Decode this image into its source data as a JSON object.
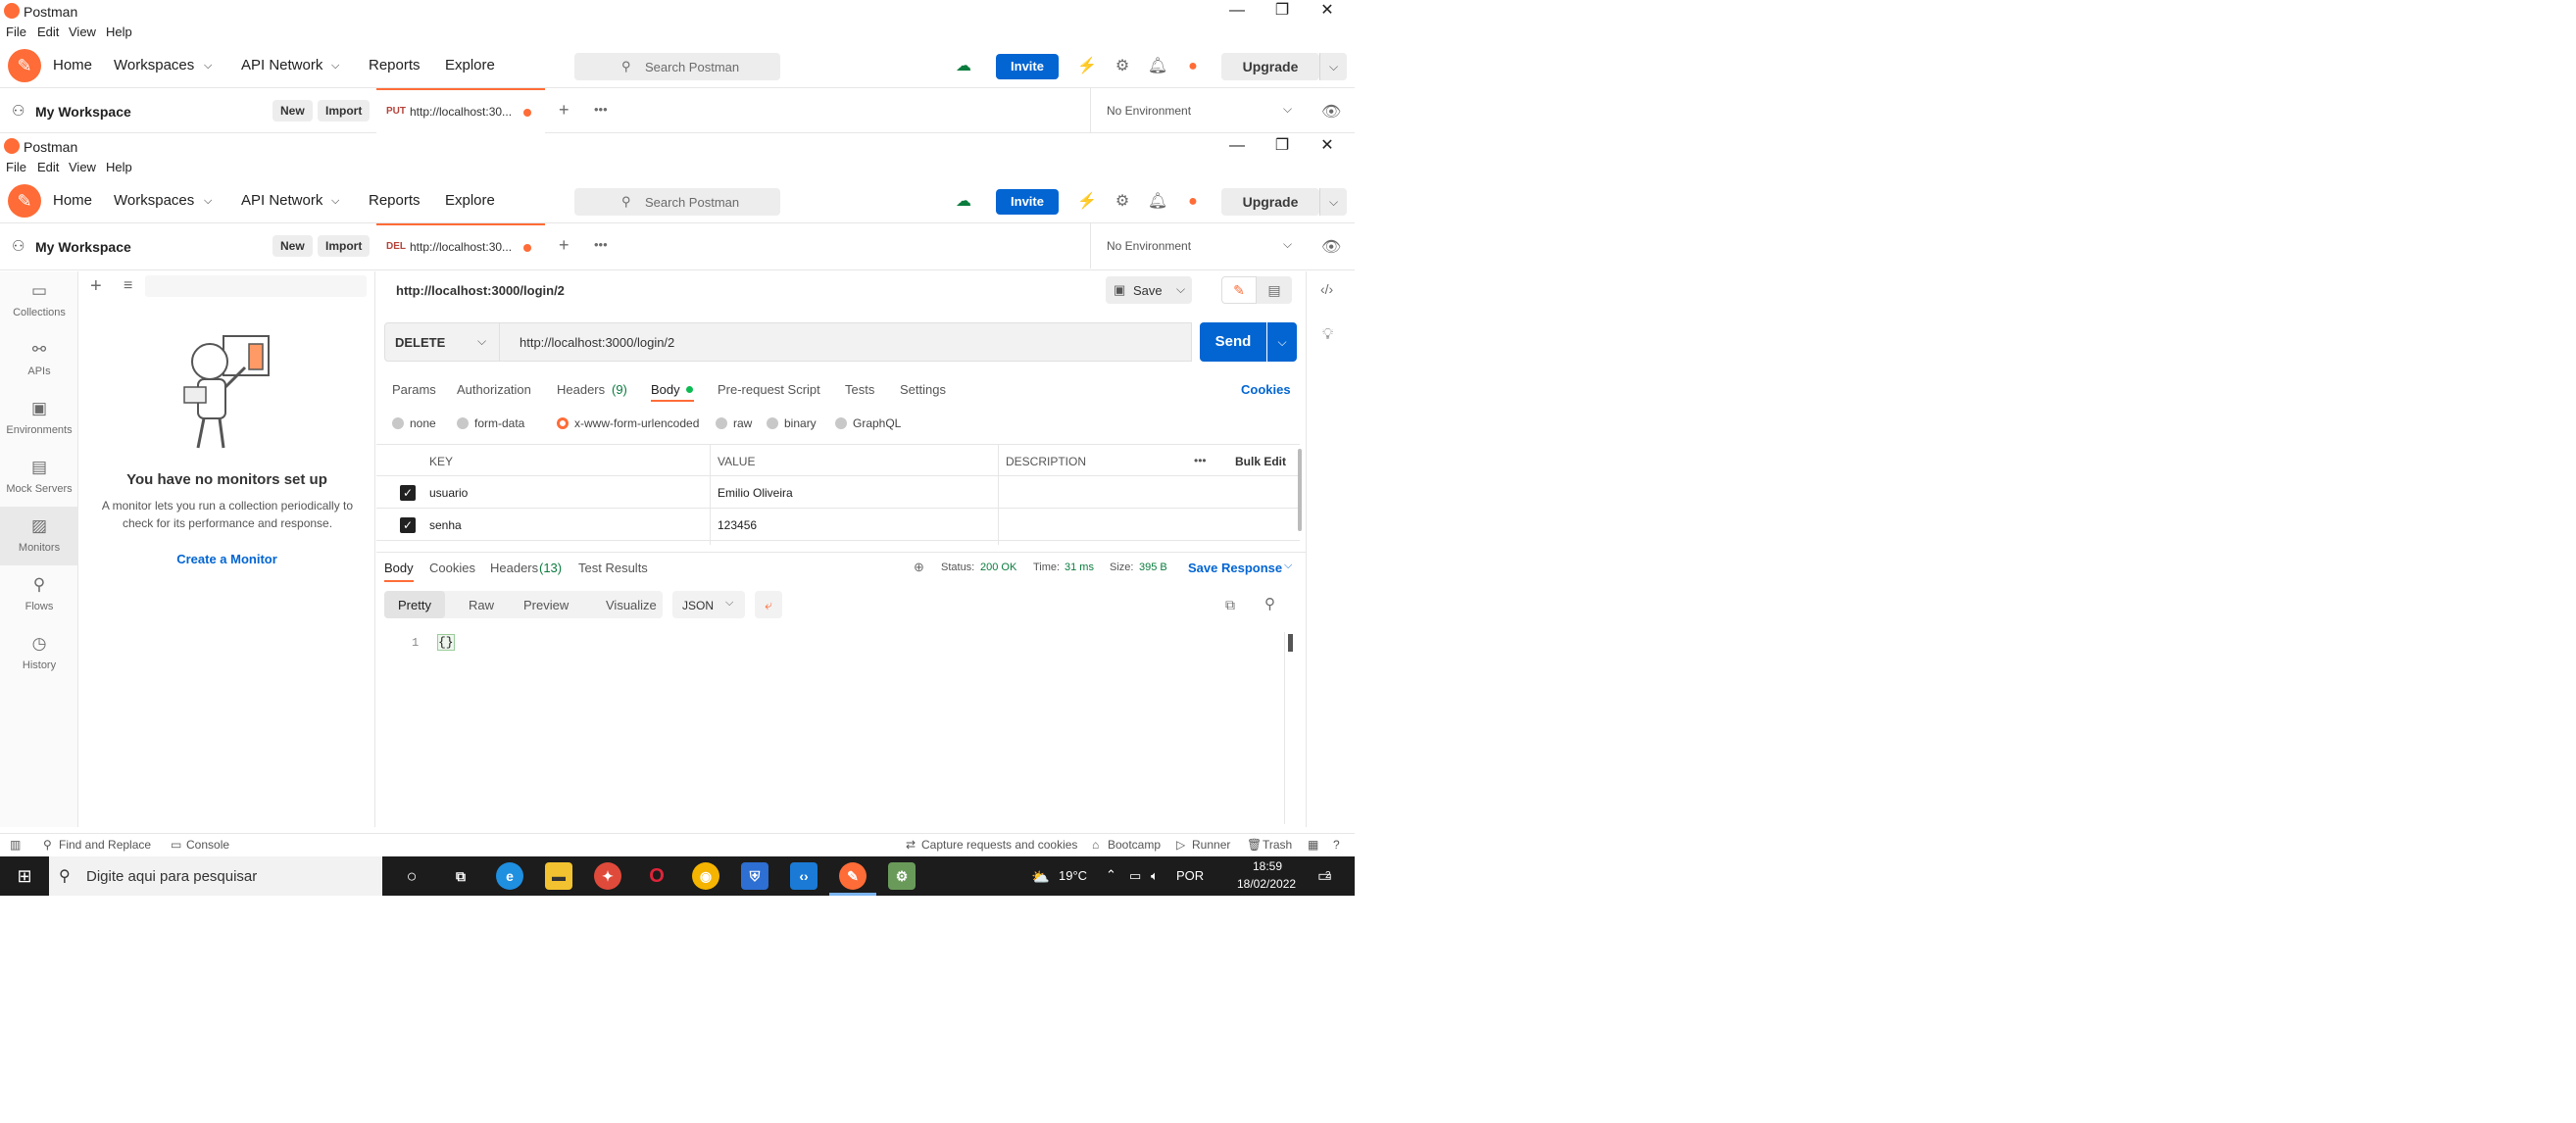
{
  "window": {
    "title": "Postman",
    "minimize": "—",
    "restore": "❐",
    "close": "✕"
  },
  "menu": {
    "file": "File",
    "edit": "Edit",
    "view": "View",
    "help": "Help"
  },
  "nav": {
    "home": "Home",
    "workspaces": "Workspaces",
    "api_network": "API Network",
    "reports": "Reports",
    "explore": "Explore",
    "search_placeholder": "Search Postman",
    "invite": "Invite",
    "upgrade": "Upgrade"
  },
  "workspace": {
    "name": "My Workspace",
    "new": "New",
    "import": "Import"
  },
  "back_tab": {
    "method": "PUT",
    "url": "http://localhost:30..."
  },
  "front_tab": {
    "method": "DEL",
    "url": "http://localhost:30..."
  },
  "environment": {
    "selected": "No Environment"
  },
  "rail": [
    {
      "label": "Collections",
      "icon": "collections-icon",
      "glyph": "▭"
    },
    {
      "label": "APIs",
      "icon": "apis-icon",
      "glyph": "⚯"
    },
    {
      "label": "Environments",
      "icon": "environments-icon",
      "glyph": "▣"
    },
    {
      "label": "Mock Servers",
      "icon": "mock-servers-icon",
      "glyph": "▤"
    },
    {
      "label": "Monitors",
      "icon": "monitors-icon",
      "glyph": "▨"
    },
    {
      "label": "Flows",
      "icon": "flows-icon",
      "glyph": "⚲"
    },
    {
      "label": "History",
      "icon": "history-icon",
      "glyph": "◷"
    }
  ],
  "monitors_panel": {
    "empty_title": "You have no monitors set up",
    "empty_desc": "A monitor lets you run a collection periodically to check for its performance and response.",
    "create_link": "Create a Monitor"
  },
  "request": {
    "name": "http://localhost:3000/login/2",
    "save": "Save",
    "method": "DELETE",
    "url": "http://localhost:3000/login/2",
    "send": "Send"
  },
  "req_tabs": [
    {
      "label": "Params"
    },
    {
      "label": "Authorization"
    },
    {
      "label": "Headers",
      "count": "(9)"
    },
    {
      "label": "Body"
    },
    {
      "label": "Pre-request Script"
    },
    {
      "label": "Tests"
    },
    {
      "label": "Settings"
    }
  ],
  "cookies": "Cookies",
  "body_types": [
    "none",
    "form-data",
    "x-www-form-urlencoded",
    "raw",
    "binary",
    "GraphQL"
  ],
  "params_table": {
    "headers": {
      "key": "KEY",
      "value": "VALUE",
      "description": "DESCRIPTION",
      "bulk_edit": "Bulk Edit",
      "more": "•••"
    },
    "rows": [
      {
        "key": "usuario",
        "value": "Emilio Oliveira",
        "description": ""
      },
      {
        "key": "senha",
        "value": "123456",
        "description": ""
      }
    ]
  },
  "response": {
    "tabs": [
      {
        "label": "Body"
      },
      {
        "label": "Cookies"
      },
      {
        "label": "Headers",
        "count": "(13)"
      },
      {
        "label": "Test Results"
      }
    ],
    "status_label": "Status:",
    "status": "200 OK",
    "time_label": "Time:",
    "time": "31 ms",
    "size_label": "Size:",
    "size": "395 B",
    "save_response": "Save Response",
    "views": [
      "Pretty",
      "Raw",
      "Preview",
      "Visualize"
    ],
    "format": "JSON",
    "line_number": "1",
    "code": "{}"
  },
  "status_bar": {
    "find_replace": "Find and Replace",
    "console": "Console",
    "capture": "Capture requests and cookies",
    "bootcamp": "Bootcamp",
    "runner": "Runner",
    "trash": "Trash"
  },
  "taskbar": {
    "search_placeholder": "Digite aqui para pesquisar",
    "temperature": "19°C",
    "language": "POR",
    "time": "18:59",
    "date": "18/02/2022",
    "notifications": "2"
  },
  "colors": {
    "accent": "#ff6c37",
    "primary": "#0265d2",
    "status_ok": "#0a7c3e",
    "taskbar": "#1c1c1c"
  }
}
